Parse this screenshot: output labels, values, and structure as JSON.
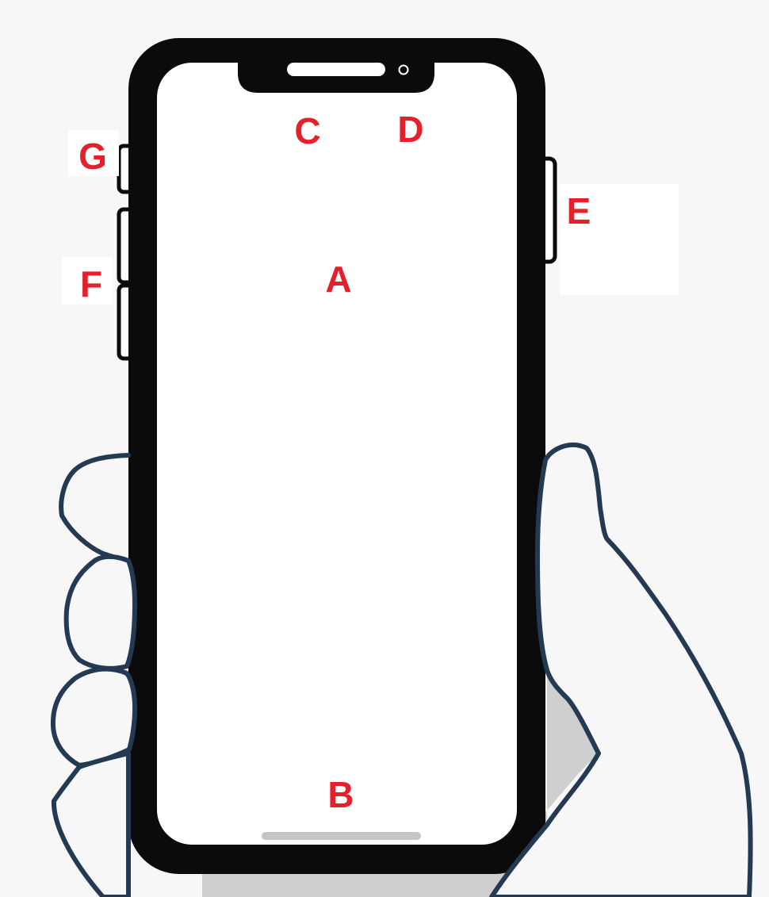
{
  "colors": {
    "background": "#f7f7f8",
    "phone_body": "#0b0b0b",
    "screen": "#ffffff",
    "hand_outline": "#233a52",
    "hand_fill": "#f7f7f8",
    "shadow": "#cfcfcf",
    "label": "#e5202a",
    "home_indicator": "#c4c4c4",
    "earpiece": "#ffffff"
  },
  "labels": {
    "screen": "A",
    "home_indicator": "B",
    "earpiece_speaker": "C",
    "front_camera": "D",
    "side_button": "E",
    "volume_buttons": "F",
    "ring_silent_switch": "G"
  }
}
